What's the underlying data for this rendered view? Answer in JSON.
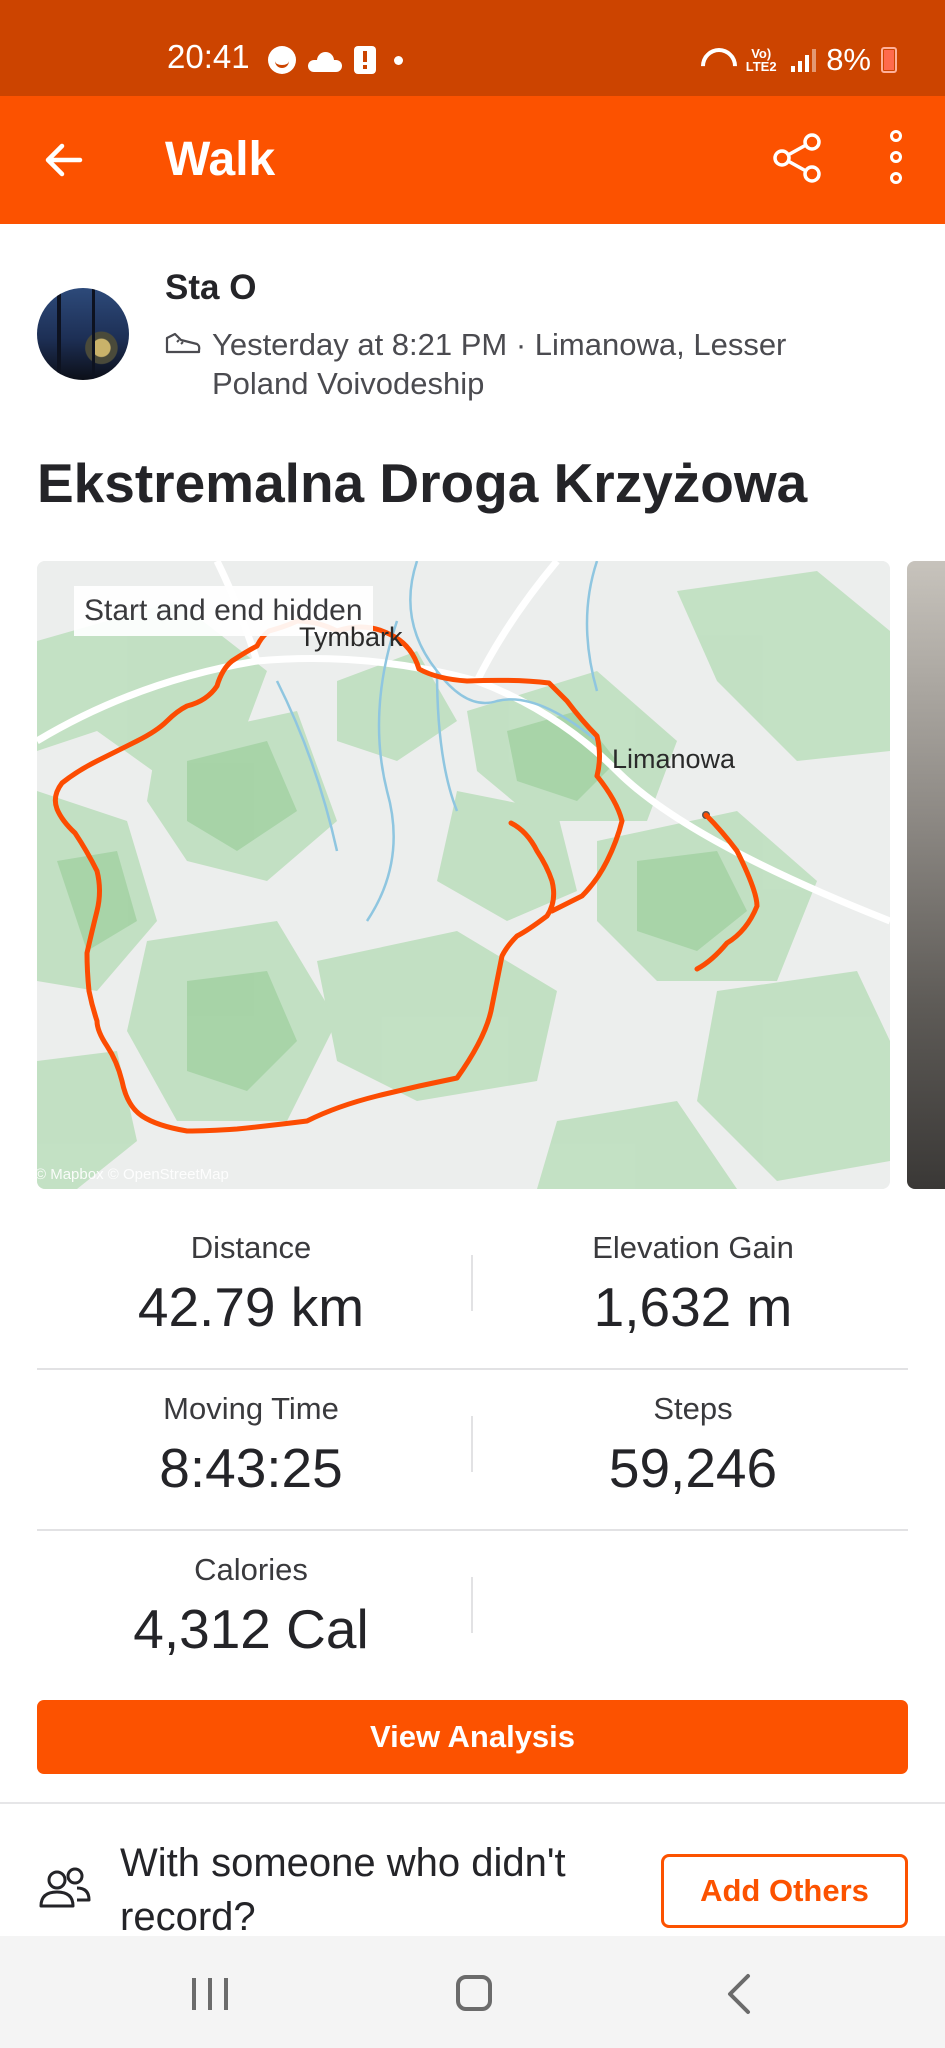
{
  "status_bar": {
    "time": "20:41",
    "battery": "8%",
    "network_label": "Vo) LTE2"
  },
  "app_bar": {
    "title": "Walk"
  },
  "athlete": {
    "name": "Sta O",
    "meta": "Yesterday at 8:21 PM · Limanowa, Lesser Poland Voivodeship"
  },
  "activity": {
    "title": "Ekstremalna Droga Krzyżowa"
  },
  "map": {
    "badge": "Start and end hidden",
    "town_1": "Tymbark",
    "town_2": "Limanowa",
    "attribution": "© Mapbox © OpenStreetMap",
    "route_color": "#fc4c02"
  },
  "stats": [
    {
      "label": "Distance",
      "value": "42.79 km"
    },
    {
      "label": "Elevation Gain",
      "value": "1,632 m"
    },
    {
      "label": "Moving Time",
      "value": "8:43:25"
    },
    {
      "label": "Steps",
      "value": "59,246"
    },
    {
      "label": "Calories",
      "value": "4,312 Cal"
    }
  ],
  "actions": {
    "view_analysis": "View Analysis",
    "with_someone": "With someone who didn't record?",
    "add_others": "Add Others"
  },
  "colors": {
    "brand": "#fc5200",
    "status_bar": "#cc4400"
  },
  "icons": {
    "back": "arrow-left-icon",
    "share": "share-icon",
    "more": "more-vertical-icon",
    "shoe": "shoe-icon",
    "group": "group-icon"
  }
}
